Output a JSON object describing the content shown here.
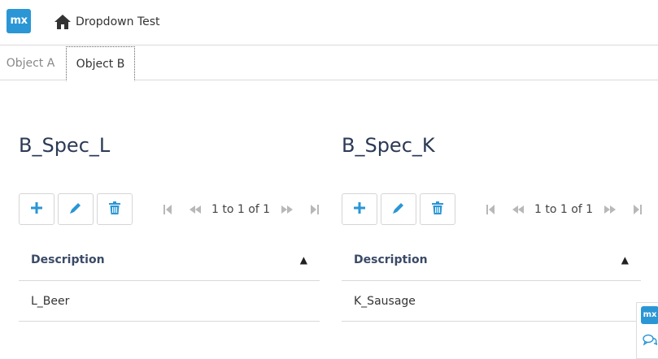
{
  "header": {
    "logo_text": "mx",
    "home_label": "Dropdown Test"
  },
  "tabs": [
    {
      "label": "Object A",
      "active": false
    },
    {
      "label": "Object B",
      "active": true
    }
  ],
  "panels": [
    {
      "title": "B_Spec_L",
      "pager_text": "1 to 1 of 1",
      "column_header": "Description",
      "sort_indicator": "▲",
      "rows": [
        "L_Beer"
      ]
    },
    {
      "title": "B_Spec_K",
      "pager_text": "1 to 1 of 1",
      "column_header": "Description",
      "sort_indicator": "▲",
      "rows": [
        "K_Sausage"
      ]
    }
  ],
  "float_widget": {
    "logo_text": "mx",
    "icons": [
      "mendix-logo-icon",
      "feedback-chat-icon"
    ]
  },
  "colors": {
    "accent": "#2a96d5",
    "title_text": "#2b3a55",
    "border": "#d9d9d9",
    "pager_inactive": "#b8b8b8"
  },
  "icons": {
    "home": "home-icon",
    "add": "plus-icon",
    "edit": "pencil-icon",
    "delete": "trash-icon",
    "first": "first-page-icon",
    "prev": "previous-page-icon",
    "next": "next-page-icon",
    "last": "last-page-icon",
    "sort": "sort-ascending-icon"
  }
}
